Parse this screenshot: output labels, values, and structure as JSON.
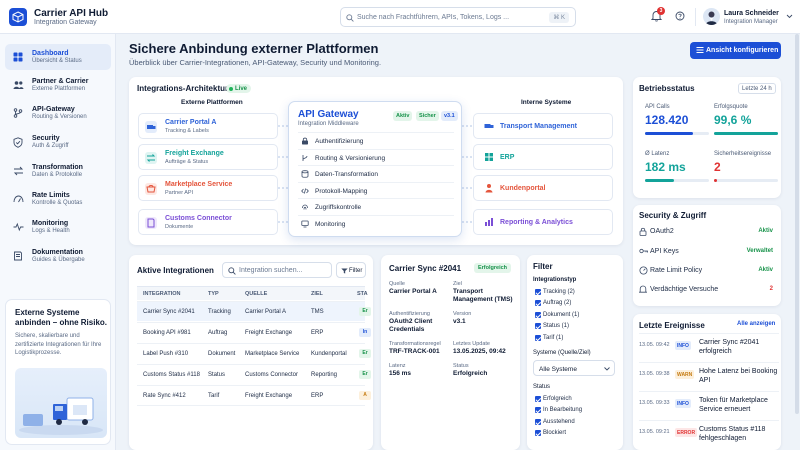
{
  "app": {
    "title": "Carrier API Hub",
    "subtitle": "Integration Gateway"
  },
  "search": {
    "placeholder": "Suche nach Frachtführern, APIs, Tokens, Logs ...",
    "shortcut": "⌘ K"
  },
  "notifications": {
    "count": "3"
  },
  "user": {
    "name": "Laura Schneider",
    "role": "Integration Manager"
  },
  "sidebar": {
    "items": [
      {
        "label": "Dashboard",
        "sub": "Übersicht & Status",
        "icon": "dashboard-icon"
      },
      {
        "label": "Partner & Carrier",
        "sub": "Externe Plattformen",
        "icon": "users-icon"
      },
      {
        "label": "API-Gateway",
        "sub": "Routing & Versionen",
        "icon": "branch-icon"
      },
      {
        "label": "Security",
        "sub": "Auth & Zugriff",
        "icon": "shield-icon"
      },
      {
        "label": "Transformation",
        "sub": "Daten & Protokolle",
        "icon": "transform-icon"
      },
      {
        "label": "Rate Limits",
        "sub": "Kontrolle & Quotas",
        "icon": "gauge-icon"
      },
      {
        "label": "Monitoring",
        "sub": "Logs & Health",
        "icon": "pulse-icon"
      },
      {
        "label": "Dokumentation",
        "sub": "Guides & Übergabe",
        "icon": "book-icon"
      }
    ],
    "promo": {
      "title": "Externe Systeme anbinden – ohne Risiko.",
      "text": "Sichere, skalierbare und zertifizierte Integrationen für Ihre Logistikprozesse."
    }
  },
  "header": {
    "title": "Sichere Anbindung externer Plattformen",
    "subtitle": "Überblick über Carrier-Integrationen, API-Gateway, Security und Monitoring.",
    "button": "Ansicht konfigurieren"
  },
  "architecture": {
    "title": "Integrations-Architektur",
    "live": "Live",
    "external_header": "Externe Plattformen",
    "internal_header": "Interne Systeme",
    "external": [
      {
        "name": "Carrier Portal A",
        "sub": "Tracking & Labels",
        "color": "#2f63d8"
      },
      {
        "name": "Freight Exchange",
        "sub": "Aufträge & Status",
        "color": "#13a39a"
      },
      {
        "name": "Marketplace Service",
        "sub": "Partner API",
        "color": "#e4553c"
      },
      {
        "name": "Customs Connector",
        "sub": "Dokumente",
        "color": "#7b4fd6"
      }
    ],
    "gateway": {
      "title": "API Gateway",
      "subtitle": "Integration Middleware",
      "status1": "Aktiv",
      "status2": "Sicher",
      "version": "v3.1",
      "functions": [
        "Authentifizierung",
        "Routing & Versionierung",
        "Daten-Transformation",
        "Protokoll-Mapping",
        "Zugriffskontrolle",
        "Monitoring"
      ]
    },
    "internal": [
      {
        "name": "Transport Management",
        "color": "#2f63d8"
      },
      {
        "name": "ERP",
        "color": "#13a39a"
      },
      {
        "name": "Kundenportal",
        "color": "#e4553c"
      },
      {
        "name": "Reporting & Analytics",
        "color": "#7b4fd6"
      }
    ]
  },
  "status": {
    "title": "Betriebsstatus",
    "period": "Letzte 24 h",
    "kpis": [
      {
        "label": "API Calls",
        "value": "128.420",
        "color": "#1c4fd6",
        "level": 0.75
      },
      {
        "label": "Erfolgsquote",
        "value": "99,6 %",
        "color": "#13a39a",
        "level": 0.996
      },
      {
        "label": "Ø Latenz",
        "value": "182 ms",
        "color": "#13a39a",
        "level": 0.45
      },
      {
        "label": "Sicherheitsereignisse",
        "value": "2",
        "color": "#e03232",
        "level": 0.05
      }
    ]
  },
  "security": {
    "title": "Security & Zugriff",
    "items": [
      {
        "label": "OAuth2",
        "value": "Aktiv",
        "color": "#17924a"
      },
      {
        "label": "API Keys",
        "value": "Verwaltet",
        "color": "#17924a"
      },
      {
        "label": "Rate Limit Policy",
        "value": "Aktiv",
        "color": "#17924a"
      },
      {
        "label": "Verdächtige Versuche",
        "value": "2",
        "color": "#e03232"
      }
    ]
  },
  "integrations": {
    "title": "Aktive Integrationen",
    "search_placeholder": "Integration suchen...",
    "filter": "Filter",
    "columns": [
      "INTEGRATION",
      "TYP",
      "QUELLE",
      "ZIEL",
      "STA"
    ],
    "rows": [
      {
        "name": "Carrier Sync #2041",
        "type": "Tracking",
        "source": "Carrier Portal A",
        "target": "TMS",
        "status": "Er",
        "sc": "#17924a",
        "sb": "#e3f5ea"
      },
      {
        "name": "Booking API #981",
        "type": "Auftrag",
        "source": "Freight Exchange",
        "target": "ERP",
        "status": "In",
        "sc": "#1c4fd6",
        "sb": "#e3ecfb"
      },
      {
        "name": "Label Push #310",
        "type": "Dokument",
        "source": "Marketplace Service",
        "target": "Kundenportal",
        "status": "Er",
        "sc": "#17924a",
        "sb": "#e3f5ea"
      },
      {
        "name": "Customs Status #118",
        "type": "Status",
        "source": "Customs Connector",
        "target": "Reporting",
        "status": "Er",
        "sc": "#17924a",
        "sb": "#e3f5ea"
      },
      {
        "name": "Rate Sync #412",
        "type": "Tarif",
        "source": "Freight Exchange",
        "target": "ERP",
        "status": "A",
        "sc": "#c57a10",
        "sb": "#fdf0dc"
      }
    ]
  },
  "detail": {
    "title": "Carrier Sync #2041",
    "status": "Erfolgreich",
    "fields": [
      {
        "label": "Quelle",
        "value": "Carrier Portal A"
      },
      {
        "label": "Ziel",
        "value": "Transport Management (TMS)"
      },
      {
        "label": "Authentifizierung",
        "value": "OAuth2 Client Credentials"
      },
      {
        "label": "Version",
        "value": "v3.1"
      },
      {
        "label": "Transformationsregel",
        "value": "TRF-TRACK-001"
      },
      {
        "label": "Letztes Update",
        "value": "13.05.2025, 09:42"
      },
      {
        "label": "Latenz",
        "value": "156 ms"
      },
      {
        "label": "Status",
        "value": "Erfolgreich"
      }
    ]
  },
  "filter": {
    "title": "Filter",
    "type_label": "Integrationstyp",
    "types": [
      "Tracking (2)",
      "Auftrag (2)",
      "Dokument (1)",
      "Status (1)",
      "Tarif (1)"
    ],
    "system_label": "Systeme (Quelle/Ziel)",
    "system_value": "Alle Systeme",
    "status_label": "Status",
    "statuses": [
      "Erfolgreich",
      "In Bearbeitung",
      "Ausstehend",
      "Blockiert"
    ]
  },
  "events": {
    "title": "Letzte Ereignisse",
    "link": "Alle anzeigen",
    "items": [
      {
        "time": "13.05. 09:42",
        "level": "INFO",
        "msg": "Carrier Sync #2041 erfolgreich",
        "c": "#1c4fd6",
        "b": "#e3ecfb"
      },
      {
        "time": "13.05. 09:38",
        "level": "WARN",
        "msg": "Hohe Latenz bei Booking API",
        "c": "#c57a10",
        "b": "#fdf0dc"
      },
      {
        "time": "13.05. 09:33",
        "level": "INFO",
        "msg": "Token für Marketplace Service erneuert",
        "c": "#1c4fd6",
        "b": "#e3ecfb"
      },
      {
        "time": "13.05. 09:21",
        "level": "ERROR",
        "msg": "Customs Status #118 fehlgeschlagen",
        "c": "#e03232",
        "b": "#fde6e6"
      }
    ]
  }
}
